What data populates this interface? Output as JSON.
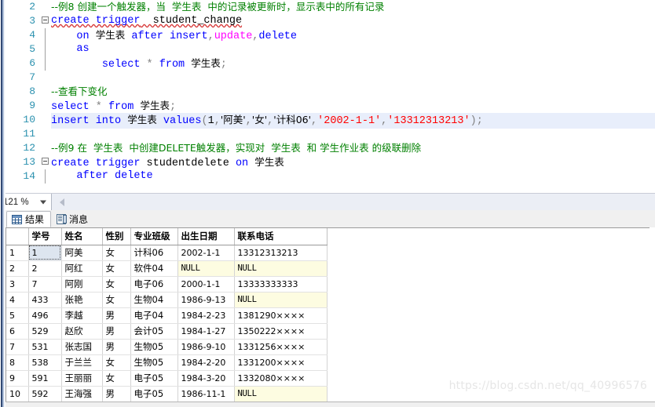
{
  "editor": {
    "zoom_level": "121 %",
    "lines": [
      {
        "num": "2",
        "fold": "none",
        "highlight": false,
        "segments": [
          {
            "t": "comment",
            "s": "--例8 创建一个触发器，当  学生表  中的记录被更新时，显示表中的所有记录"
          }
        ]
      },
      {
        "num": "3",
        "fold": "box",
        "highlight": false,
        "segments": [
          {
            "t": "kw-sq",
            "s": "create trigger"
          },
          {
            "t": "plain-sq",
            "s": "  student_change"
          }
        ]
      },
      {
        "num": "4",
        "fold": "bar",
        "highlight": false,
        "segments": [
          {
            "t": "plain",
            "s": "    "
          },
          {
            "t": "kw",
            "s": "on"
          },
          {
            "t": "plain",
            "s": " "
          },
          {
            "t": "cn",
            "s": "学生表"
          },
          {
            "t": "plain",
            "s": " "
          },
          {
            "t": "kw",
            "s": "after"
          },
          {
            "t": "plain",
            "s": " "
          },
          {
            "t": "kw",
            "s": "insert"
          },
          {
            "t": "punct",
            "s": ","
          },
          {
            "t": "kw2",
            "s": "update"
          },
          {
            "t": "punct",
            "s": ","
          },
          {
            "t": "kw",
            "s": "delete"
          }
        ]
      },
      {
        "num": "5",
        "fold": "bar",
        "highlight": false,
        "segments": [
          {
            "t": "plain",
            "s": "    "
          },
          {
            "t": "kw",
            "s": "as"
          }
        ]
      },
      {
        "num": "6",
        "fold": "bar",
        "highlight": false,
        "segments": [
          {
            "t": "plain",
            "s": "        "
          },
          {
            "t": "kw",
            "s": "select"
          },
          {
            "t": "plain",
            "s": " "
          },
          {
            "t": "punct",
            "s": "*"
          },
          {
            "t": "plain",
            "s": " "
          },
          {
            "t": "kw",
            "s": "from"
          },
          {
            "t": "plain",
            "s": " "
          },
          {
            "t": "cn",
            "s": "学生表"
          },
          {
            "t": "punct",
            "s": ";"
          }
        ]
      },
      {
        "num": "7",
        "fold": "none",
        "highlight": false,
        "segments": []
      },
      {
        "num": "8",
        "fold": "none",
        "highlight": false,
        "segments": [
          {
            "t": "comment",
            "s": "--查看下变化"
          }
        ]
      },
      {
        "num": "9",
        "fold": "none",
        "highlight": false,
        "segments": [
          {
            "t": "kw",
            "s": "select"
          },
          {
            "t": "plain",
            "s": " "
          },
          {
            "t": "punct",
            "s": "*"
          },
          {
            "t": "plain",
            "s": " "
          },
          {
            "t": "kw",
            "s": "from"
          },
          {
            "t": "plain",
            "s": " "
          },
          {
            "t": "cn",
            "s": "学生表"
          },
          {
            "t": "punct",
            "s": ";"
          }
        ]
      },
      {
        "num": "10",
        "fold": "none",
        "highlight": true,
        "segments": [
          {
            "t": "kw",
            "s": "insert into"
          },
          {
            "t": "plain",
            "s": " "
          },
          {
            "t": "cn",
            "s": "学生表"
          },
          {
            "t": "plain",
            "s": " "
          },
          {
            "t": "kw",
            "s": "values"
          },
          {
            "t": "punct",
            "s": "("
          },
          {
            "t": "num",
            "s": "1"
          },
          {
            "t": "punct",
            "s": ","
          },
          {
            "t": "str-cn",
            "s": "'阿美'"
          },
          {
            "t": "punct",
            "s": ","
          },
          {
            "t": "str-cn",
            "s": "'女'"
          },
          {
            "t": "punct",
            "s": ","
          },
          {
            "t": "str-cn",
            "s": "'计科06'"
          },
          {
            "t": "punct",
            "s": ","
          },
          {
            "t": "str",
            "s": "'2002-1-1'"
          },
          {
            "t": "punct",
            "s": ","
          },
          {
            "t": "str",
            "s": "'13312313213'"
          },
          {
            "t": "punct",
            "s": ");"
          }
        ]
      },
      {
        "num": "11",
        "fold": "none",
        "highlight": false,
        "segments": []
      },
      {
        "num": "12",
        "fold": "none",
        "highlight": false,
        "segments": [
          {
            "t": "comment",
            "s": "--例9 在  学生表  中创建DELETE触发器，实现对  学生表  和 学生作业表 的级联删除"
          }
        ]
      },
      {
        "num": "13",
        "fold": "box",
        "highlight": false,
        "segments": [
          {
            "t": "kw",
            "s": "create trigger"
          },
          {
            "t": "plain",
            "s": " studentdelete "
          },
          {
            "t": "kw",
            "s": "on"
          },
          {
            "t": "plain",
            "s": " "
          },
          {
            "t": "cn",
            "s": "学生表"
          }
        ]
      },
      {
        "num": "14",
        "fold": "bar",
        "highlight": false,
        "segments": [
          {
            "t": "plain",
            "s": "    "
          },
          {
            "t": "kw",
            "s": "after delete"
          }
        ]
      }
    ]
  },
  "results_tabs": [
    {
      "label": "结果",
      "icon": "grid-icon",
      "active": true
    },
    {
      "label": "消息",
      "icon": "message-icon",
      "active": false
    }
  ],
  "grid": {
    "row_header": "",
    "columns": [
      "学号",
      "姓名",
      "性别",
      "专业班级",
      "出生日期",
      "联系电话"
    ],
    "null_text": "NULL",
    "rows": [
      {
        "n": "1",
        "cells": [
          "1",
          "阿美",
          "女",
          "计科06",
          "2002-1-1",
          "13312313213"
        ]
      },
      {
        "n": "2",
        "cells": [
          "2",
          "阿红",
          "女",
          "软件04",
          "NULL",
          "NULL"
        ]
      },
      {
        "n": "3",
        "cells": [
          "7",
          "阿刚",
          "女",
          "电子06",
          "2000-1-1",
          "13333333333"
        ]
      },
      {
        "n": "4",
        "cells": [
          "433",
          "张艳",
          "女",
          "生物04",
          "1986-9-13",
          "NULL"
        ]
      },
      {
        "n": "5",
        "cells": [
          "496",
          "李越",
          "男",
          "电子04",
          "1984-2-23",
          "1381290××××"
        ]
      },
      {
        "n": "6",
        "cells": [
          "529",
          "赵欣",
          "男",
          "会计05",
          "1984-1-27",
          "1350222××××"
        ]
      },
      {
        "n": "7",
        "cells": [
          "531",
          "张志国",
          "男",
          "生物05",
          "1986-9-10",
          "1331256××××"
        ]
      },
      {
        "n": "8",
        "cells": [
          "538",
          "于兰兰",
          "女",
          "生物05",
          "1984-2-20",
          "1331200××××"
        ]
      },
      {
        "n": "9",
        "cells": [
          "591",
          "王丽丽",
          "女",
          "电子05",
          "1984-3-20",
          "1332080××××"
        ]
      },
      {
        "n": "10",
        "cells": [
          "592",
          "王海强",
          "男",
          "电子05",
          "1986-11-1",
          "NULL"
        ]
      }
    ],
    "selected": {
      "row": 0,
      "col": 0
    }
  },
  "watermark": {
    "text": "https://blog.csdn.net/qq_40996576"
  },
  "colors": {
    "comment": "#008000",
    "keyword": "#0000ff",
    "keyword_alt": "#ff00ff",
    "string": "#ff0000",
    "line_number": "#2b91af",
    "selection": "#e8eefb",
    "null_bg": "#fdfce1",
    "cell_selected_bg": "#dde5ef"
  }
}
